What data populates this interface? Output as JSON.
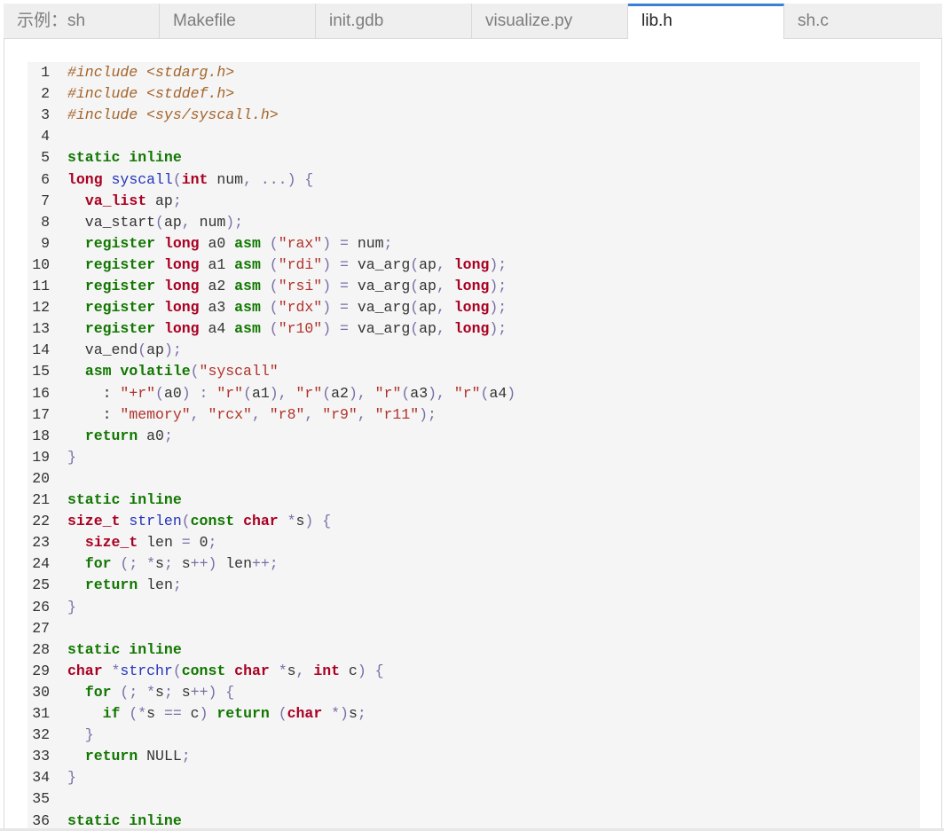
{
  "tabs": [
    {
      "label": "示例：sh",
      "active": false
    },
    {
      "label": "Makefile",
      "active": false
    },
    {
      "label": "init.gdb",
      "active": false
    },
    {
      "label": "visualize.py",
      "active": false
    },
    {
      "label": "lib.h",
      "active": true
    },
    {
      "label": "sh.c",
      "active": false
    }
  ],
  "colors": {
    "accent_tab": "#3a7fd5",
    "keyword": "#117700",
    "type": "#aa0022",
    "function": "#2233bb",
    "string": "#b0322a",
    "preprocessor": "#a4642a",
    "editor_bg": "#f5f5f5"
  },
  "code": {
    "language": "c",
    "lines": [
      [
        [
          "com",
          "#include <stdarg.h>"
        ]
      ],
      [
        [
          "com",
          "#include <stddef.h>"
        ]
      ],
      [
        [
          "com",
          "#include <sys/syscall.h>"
        ]
      ],
      [],
      [
        [
          "kw",
          "static inline"
        ]
      ],
      [
        [
          "ty",
          "long "
        ],
        [
          "fn",
          "syscall"
        ],
        [
          "op",
          "("
        ],
        [
          "ty",
          "int"
        ],
        [
          "pl",
          " num"
        ],
        [
          "op",
          ", ...) {"
        ]
      ],
      [
        [
          "pl",
          "  "
        ],
        [
          "ty",
          "va_list"
        ],
        [
          "pl",
          " ap"
        ],
        [
          "op",
          ";"
        ]
      ],
      [
        [
          "pl",
          "  va_start"
        ],
        [
          "op",
          "("
        ],
        [
          "pl",
          "ap"
        ],
        [
          "op",
          ", "
        ],
        [
          "pl",
          "num"
        ],
        [
          "op",
          ");"
        ]
      ],
      [
        [
          "pl",
          "  "
        ],
        [
          "kw",
          "register"
        ],
        [
          "pl",
          " "
        ],
        [
          "ty",
          "long"
        ],
        [
          "pl",
          " a0 "
        ],
        [
          "kw",
          "asm"
        ],
        [
          "op",
          " ("
        ],
        [
          "str",
          "\"rax\""
        ],
        [
          "op",
          ") = "
        ],
        [
          "pl",
          "num"
        ],
        [
          "op",
          ";"
        ]
      ],
      [
        [
          "pl",
          "  "
        ],
        [
          "kw",
          "register"
        ],
        [
          "pl",
          " "
        ],
        [
          "ty",
          "long"
        ],
        [
          "pl",
          " a1 "
        ],
        [
          "kw",
          "asm"
        ],
        [
          "op",
          " ("
        ],
        [
          "str",
          "\"rdi\""
        ],
        [
          "op",
          ") = "
        ],
        [
          "pl",
          "va_arg"
        ],
        [
          "op",
          "("
        ],
        [
          "pl",
          "ap"
        ],
        [
          "op",
          ", "
        ],
        [
          "ty",
          "long"
        ],
        [
          "op",
          ");"
        ]
      ],
      [
        [
          "pl",
          "  "
        ],
        [
          "kw",
          "register"
        ],
        [
          "pl",
          " "
        ],
        [
          "ty",
          "long"
        ],
        [
          "pl",
          " a2 "
        ],
        [
          "kw",
          "asm"
        ],
        [
          "op",
          " ("
        ],
        [
          "str",
          "\"rsi\""
        ],
        [
          "op",
          ") = "
        ],
        [
          "pl",
          "va_arg"
        ],
        [
          "op",
          "("
        ],
        [
          "pl",
          "ap"
        ],
        [
          "op",
          ", "
        ],
        [
          "ty",
          "long"
        ],
        [
          "op",
          ");"
        ]
      ],
      [
        [
          "pl",
          "  "
        ],
        [
          "kw",
          "register"
        ],
        [
          "pl",
          " "
        ],
        [
          "ty",
          "long"
        ],
        [
          "pl",
          " a3 "
        ],
        [
          "kw",
          "asm"
        ],
        [
          "op",
          " ("
        ],
        [
          "str",
          "\"rdx\""
        ],
        [
          "op",
          ") = "
        ],
        [
          "pl",
          "va_arg"
        ],
        [
          "op",
          "("
        ],
        [
          "pl",
          "ap"
        ],
        [
          "op",
          ", "
        ],
        [
          "ty",
          "long"
        ],
        [
          "op",
          ");"
        ]
      ],
      [
        [
          "pl",
          "  "
        ],
        [
          "kw",
          "register"
        ],
        [
          "pl",
          " "
        ],
        [
          "ty",
          "long"
        ],
        [
          "pl",
          " a4 "
        ],
        [
          "kw",
          "asm"
        ],
        [
          "op",
          " ("
        ],
        [
          "str",
          "\"r10\""
        ],
        [
          "op",
          ") = "
        ],
        [
          "pl",
          "va_arg"
        ],
        [
          "op",
          "("
        ],
        [
          "pl",
          "ap"
        ],
        [
          "op",
          ", "
        ],
        [
          "ty",
          "long"
        ],
        [
          "op",
          ");"
        ]
      ],
      [
        [
          "pl",
          "  va_end"
        ],
        [
          "op",
          "("
        ],
        [
          "pl",
          "ap"
        ],
        [
          "op",
          ");"
        ]
      ],
      [
        [
          "pl",
          "  "
        ],
        [
          "kw",
          "asm volatile"
        ],
        [
          "op",
          "("
        ],
        [
          "str",
          "\"syscall\""
        ]
      ],
      [
        [
          "pl",
          "    : "
        ],
        [
          "str",
          "\"+r\""
        ],
        [
          "op",
          "("
        ],
        [
          "pl",
          "a0"
        ],
        [
          "op",
          ") : "
        ],
        [
          "str",
          "\"r\""
        ],
        [
          "op",
          "("
        ],
        [
          "pl",
          "a1"
        ],
        [
          "op",
          "), "
        ],
        [
          "str",
          "\"r\""
        ],
        [
          "op",
          "("
        ],
        [
          "pl",
          "a2"
        ],
        [
          "op",
          "), "
        ],
        [
          "str",
          "\"r\""
        ],
        [
          "op",
          "("
        ],
        [
          "pl",
          "a3"
        ],
        [
          "op",
          "), "
        ],
        [
          "str",
          "\"r\""
        ],
        [
          "op",
          "("
        ],
        [
          "pl",
          "a4"
        ],
        [
          "op",
          ")"
        ]
      ],
      [
        [
          "pl",
          "    : "
        ],
        [
          "str",
          "\"memory\""
        ],
        [
          "op",
          ", "
        ],
        [
          "str",
          "\"rcx\""
        ],
        [
          "op",
          ", "
        ],
        [
          "str",
          "\"r8\""
        ],
        [
          "op",
          ", "
        ],
        [
          "str",
          "\"r9\""
        ],
        [
          "op",
          ", "
        ],
        [
          "str",
          "\"r11\""
        ],
        [
          "op",
          ");"
        ]
      ],
      [
        [
          "pl",
          "  "
        ],
        [
          "kw",
          "return"
        ],
        [
          "pl",
          " a0"
        ],
        [
          "op",
          ";"
        ]
      ],
      [
        [
          "op",
          "}"
        ]
      ],
      [],
      [
        [
          "kw",
          "static inline"
        ]
      ],
      [
        [
          "ty",
          "size_t "
        ],
        [
          "fn",
          "strlen"
        ],
        [
          "op",
          "("
        ],
        [
          "kw",
          "const"
        ],
        [
          "pl",
          " "
        ],
        [
          "ty",
          "char"
        ],
        [
          "pl",
          " "
        ],
        [
          "op",
          "*"
        ],
        [
          "pl",
          "s"
        ],
        [
          "op",
          ") {"
        ]
      ],
      [
        [
          "pl",
          "  "
        ],
        [
          "ty",
          "size_t"
        ],
        [
          "pl",
          " len "
        ],
        [
          "op",
          "= "
        ],
        [
          "pl",
          "0"
        ],
        [
          "op",
          ";"
        ]
      ],
      [
        [
          "pl",
          "  "
        ],
        [
          "kw",
          "for"
        ],
        [
          "op",
          " (; *"
        ],
        [
          "pl",
          "s"
        ],
        [
          "op",
          "; "
        ],
        [
          "pl",
          "s"
        ],
        [
          "op",
          "++) "
        ],
        [
          "pl",
          "len"
        ],
        [
          "op",
          "++;"
        ]
      ],
      [
        [
          "pl",
          "  "
        ],
        [
          "kw",
          "return"
        ],
        [
          "pl",
          " len"
        ],
        [
          "op",
          ";"
        ]
      ],
      [
        [
          "op",
          "}"
        ]
      ],
      [],
      [
        [
          "kw",
          "static inline"
        ]
      ],
      [
        [
          "ty",
          "char "
        ],
        [
          "op",
          "*"
        ],
        [
          "fn",
          "strchr"
        ],
        [
          "op",
          "("
        ],
        [
          "kw",
          "const"
        ],
        [
          "pl",
          " "
        ],
        [
          "ty",
          "char"
        ],
        [
          "pl",
          " "
        ],
        [
          "op",
          "*"
        ],
        [
          "pl",
          "s"
        ],
        [
          "op",
          ", "
        ],
        [
          "ty",
          "int"
        ],
        [
          "pl",
          " c"
        ],
        [
          "op",
          ") {"
        ]
      ],
      [
        [
          "pl",
          "  "
        ],
        [
          "kw",
          "for"
        ],
        [
          "op",
          " (; *"
        ],
        [
          "pl",
          "s"
        ],
        [
          "op",
          "; "
        ],
        [
          "pl",
          "s"
        ],
        [
          "op",
          "++) {"
        ]
      ],
      [
        [
          "pl",
          "    "
        ],
        [
          "kw",
          "if"
        ],
        [
          "op",
          " (*"
        ],
        [
          "pl",
          "s"
        ],
        [
          "op",
          " == "
        ],
        [
          "pl",
          "c"
        ],
        [
          "op",
          ") "
        ],
        [
          "kw",
          "return"
        ],
        [
          "op",
          " ("
        ],
        [
          "ty",
          "char"
        ],
        [
          "op",
          " *)"
        ],
        [
          "pl",
          "s"
        ],
        [
          "op",
          ";"
        ]
      ],
      [
        [
          "op",
          "  }"
        ]
      ],
      [
        [
          "pl",
          "  "
        ],
        [
          "kw",
          "return"
        ],
        [
          "pl",
          " NULL"
        ],
        [
          "op",
          ";"
        ]
      ],
      [
        [
          "op",
          "}"
        ]
      ],
      [],
      [
        [
          "kw",
          "static inline"
        ]
      ]
    ]
  }
}
